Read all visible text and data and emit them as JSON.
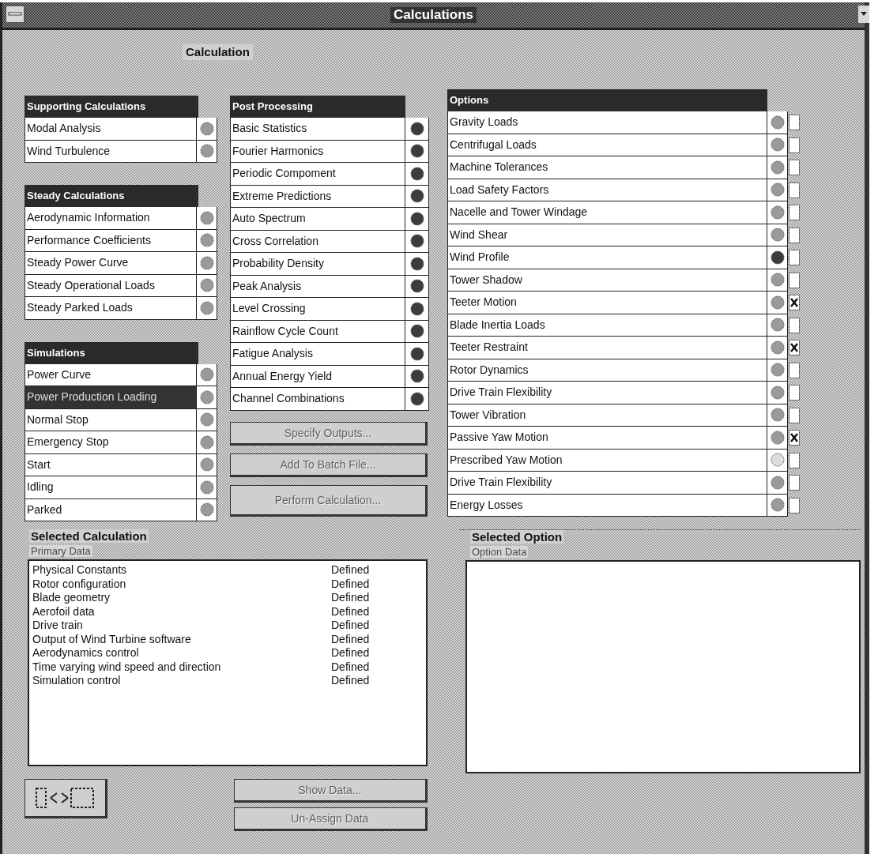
{
  "window": {
    "title": "Calculations"
  },
  "heading": "Calculation",
  "groups": [
    {
      "title": "Supporting Calculations",
      "items": [
        {
          "label": "Modal Analysis",
          "active": false,
          "selected": false
        },
        {
          "label": "Wind Turbulence",
          "active": false,
          "selected": false
        }
      ]
    },
    {
      "title": "Steady Calculations",
      "items": [
        {
          "label": "Aerodynamic Information",
          "active": false,
          "selected": false
        },
        {
          "label": "Performance Coefficients",
          "active": false,
          "selected": false
        },
        {
          "label": "Steady Power Curve",
          "active": false,
          "selected": false
        },
        {
          "label": "Steady Operational Loads",
          "active": false,
          "selected": false
        },
        {
          "label": "Steady Parked Loads",
          "active": false,
          "selected": false
        }
      ]
    },
    {
      "title": "Simulations",
      "items": [
        {
          "label": "Power Curve",
          "active": false,
          "selected": false
        },
        {
          "label": "Power Production Loading",
          "active": false,
          "selected": true
        },
        {
          "label": "Normal Stop",
          "active": false,
          "selected": false
        },
        {
          "label": "Emergency Stop",
          "active": false,
          "selected": false
        },
        {
          "label": "Start",
          "active": false,
          "selected": false
        },
        {
          "label": "Idling",
          "active": false,
          "selected": false
        },
        {
          "label": "Parked",
          "active": false,
          "selected": false
        }
      ]
    }
  ],
  "post_processing": {
    "title": "Post Processing",
    "items": [
      {
        "label": "Basic Statistics",
        "active": true,
        "selected": false
      },
      {
        "label": "Fourier Harmonics",
        "active": true,
        "selected": false
      },
      {
        "label": "Periodic Compoment",
        "active": true,
        "selected": false
      },
      {
        "label": "Extreme Predictions",
        "active": true,
        "selected": false
      },
      {
        "label": "Auto Spectrum",
        "active": true,
        "selected": false
      },
      {
        "label": "Cross Correlation",
        "active": true,
        "selected": false
      },
      {
        "label": "Probability Density",
        "active": true,
        "selected": false
      },
      {
        "label": "Peak Analysis",
        "active": true,
        "selected": false
      },
      {
        "label": "Level Crossing",
        "active": true,
        "selected": false
      },
      {
        "label": "Rainflow Cycle Count",
        "active": true,
        "selected": false
      },
      {
        "label": "Fatigue Analysis",
        "active": true,
        "selected": false
      },
      {
        "label": "Annual Energy Yield",
        "active": true,
        "selected": false
      },
      {
        "label": "Channel Combinations",
        "active": true,
        "selected": false
      }
    ]
  },
  "action_buttons": [
    {
      "label": "Specify Outputs...",
      "disabled": true
    },
    {
      "label": "Add To Batch File...",
      "disabled": true
    },
    {
      "label": "Perform Calculation...",
      "disabled": true
    }
  ],
  "options": {
    "title": "Options",
    "items": [
      {
        "label": "Gravity Loads",
        "active": false,
        "disabled": false,
        "checked": false,
        "selected": false
      },
      {
        "label": "Centrifugal Loads",
        "active": false,
        "disabled": false,
        "checked": false,
        "selected": false
      },
      {
        "label": "Machine Tolerances",
        "active": false,
        "disabled": false,
        "checked": false,
        "selected": false
      },
      {
        "label": "Load Safety Factors",
        "active": false,
        "disabled": false,
        "checked": false,
        "selected": false
      },
      {
        "label": "Nacelle and Tower Windage",
        "active": false,
        "disabled": false,
        "checked": false,
        "selected": false
      },
      {
        "label": "Wind Shear",
        "active": false,
        "disabled": false,
        "checked": false,
        "selected": false
      },
      {
        "label": "Wind Profile",
        "active": true,
        "disabled": false,
        "checked": false,
        "selected": false
      },
      {
        "label": "Tower Shadow",
        "active": false,
        "disabled": false,
        "checked": false,
        "selected": false
      },
      {
        "label": "Teeter Motion",
        "active": false,
        "disabled": false,
        "checked": true,
        "selected": false
      },
      {
        "label": "Blade Inertia Loads",
        "active": false,
        "disabled": false,
        "checked": false,
        "selected": false
      },
      {
        "label": "Teeter Restraint",
        "active": false,
        "disabled": false,
        "checked": true,
        "selected": false
      },
      {
        "label": "Rotor Dynamics",
        "active": false,
        "disabled": false,
        "checked": false,
        "selected": false
      },
      {
        "label": "Drive Train Flexibility",
        "active": false,
        "disabled": false,
        "checked": false,
        "selected": false
      },
      {
        "label": "Tower Vibration",
        "active": false,
        "disabled": false,
        "checked": false,
        "selected": false
      },
      {
        "label": "Passive Yaw Motion",
        "active": false,
        "disabled": false,
        "checked": true,
        "selected": false
      },
      {
        "label": "Prescribed Yaw Motion",
        "active": false,
        "disabled": true,
        "checked": false,
        "selected": false
      },
      {
        "label": "Drive Train Flexibility",
        "active": false,
        "disabled": false,
        "checked": false,
        "selected": false
      },
      {
        "label": "Energy Losses",
        "active": false,
        "disabled": false,
        "checked": false,
        "selected": false
      }
    ]
  },
  "selected_calculation": {
    "title": "Selected Calculation",
    "list_label": "Primary Data",
    "rows": [
      {
        "name": "Physical Constants",
        "status": "Defined"
      },
      {
        "name": "Rotor configuration",
        "status": "Defined"
      },
      {
        "name": "Blade geometry",
        "status": "Defined"
      },
      {
        "name": "Aerofoil data",
        "status": "Defined"
      },
      {
        "name": "Drive train",
        "status": "Defined"
      },
      {
        "name": "Output of Wind Turbine software",
        "status": "Defined"
      },
      {
        "name": "Aerodynamics control",
        "status": "Defined"
      },
      {
        "name": "Time varying wind speed and direction",
        "status": "Defined"
      },
      {
        "name": "Simulation control",
        "status": "Defined"
      }
    ]
  },
  "data_buttons": [
    {
      "label": "Show Data...",
      "disabled": true
    },
    {
      "label": "Un-Assign Data",
      "disabled": true
    }
  ],
  "selected_option": {
    "title": "Selected Option",
    "list_label": "Option Data"
  }
}
